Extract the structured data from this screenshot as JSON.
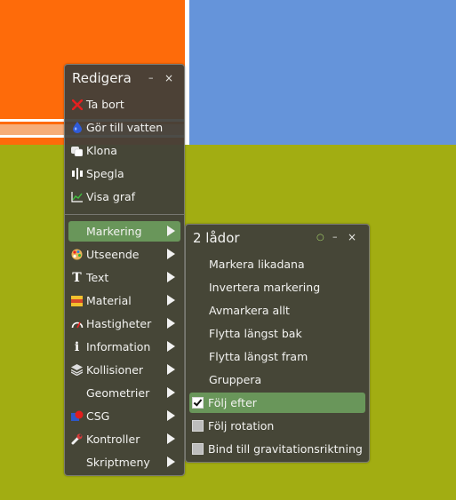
{
  "edit_menu": {
    "title": "Redigera",
    "minimize": "–",
    "close": "×",
    "actions": [
      {
        "label": "Ta bort",
        "icon": "red-x-icon"
      },
      {
        "label": "Gör till vatten",
        "icon": "water-drop-icon"
      },
      {
        "label": "Klona",
        "icon": "clone-icon"
      },
      {
        "label": "Spegla",
        "icon": "mirror-icon"
      },
      {
        "label": "Visa graf",
        "icon": "graph-icon"
      }
    ],
    "submenus": [
      {
        "label": "Markering",
        "icon": "",
        "highlighted": true
      },
      {
        "label": "Utseende",
        "icon": "palette-icon"
      },
      {
        "label": "Text",
        "icon": "text-icon"
      },
      {
        "label": "Material",
        "icon": "material-icon"
      },
      {
        "label": "Hastigheter",
        "icon": "speedometer-icon"
      },
      {
        "label": "Information",
        "icon": "info-icon"
      },
      {
        "label": "Kollisioner",
        "icon": "layers-icon"
      },
      {
        "label": "Geometrier",
        "icon": ""
      },
      {
        "label": "CSG",
        "icon": "csg-icon"
      },
      {
        "label": "Kontroller",
        "icon": "wrench-icon"
      },
      {
        "label": "Skriptmeny",
        "icon": ""
      }
    ]
  },
  "selection_menu": {
    "title": "2 lådor",
    "pin": "○",
    "minimize": "–",
    "close": "×",
    "items": [
      {
        "label": "Markera likadana"
      },
      {
        "label": "Invertera markering"
      },
      {
        "label": "Avmarkera allt"
      },
      {
        "label": "Flytta längst bak"
      },
      {
        "label": "Flytta längst fram"
      },
      {
        "label": "Gruppera"
      }
    ],
    "checks": [
      {
        "label": "Följ efter",
        "checked": true,
        "highlighted": true
      },
      {
        "label": "Följ rotation",
        "checked": false
      },
      {
        "label": "Bind till gravitationsriktning",
        "checked": false
      }
    ]
  },
  "colors": {
    "orange": "#fe6b0a",
    "blue": "#6594da",
    "green": "#a2ad12",
    "highlight": "#69965a",
    "panel": "#3e3e3a"
  }
}
